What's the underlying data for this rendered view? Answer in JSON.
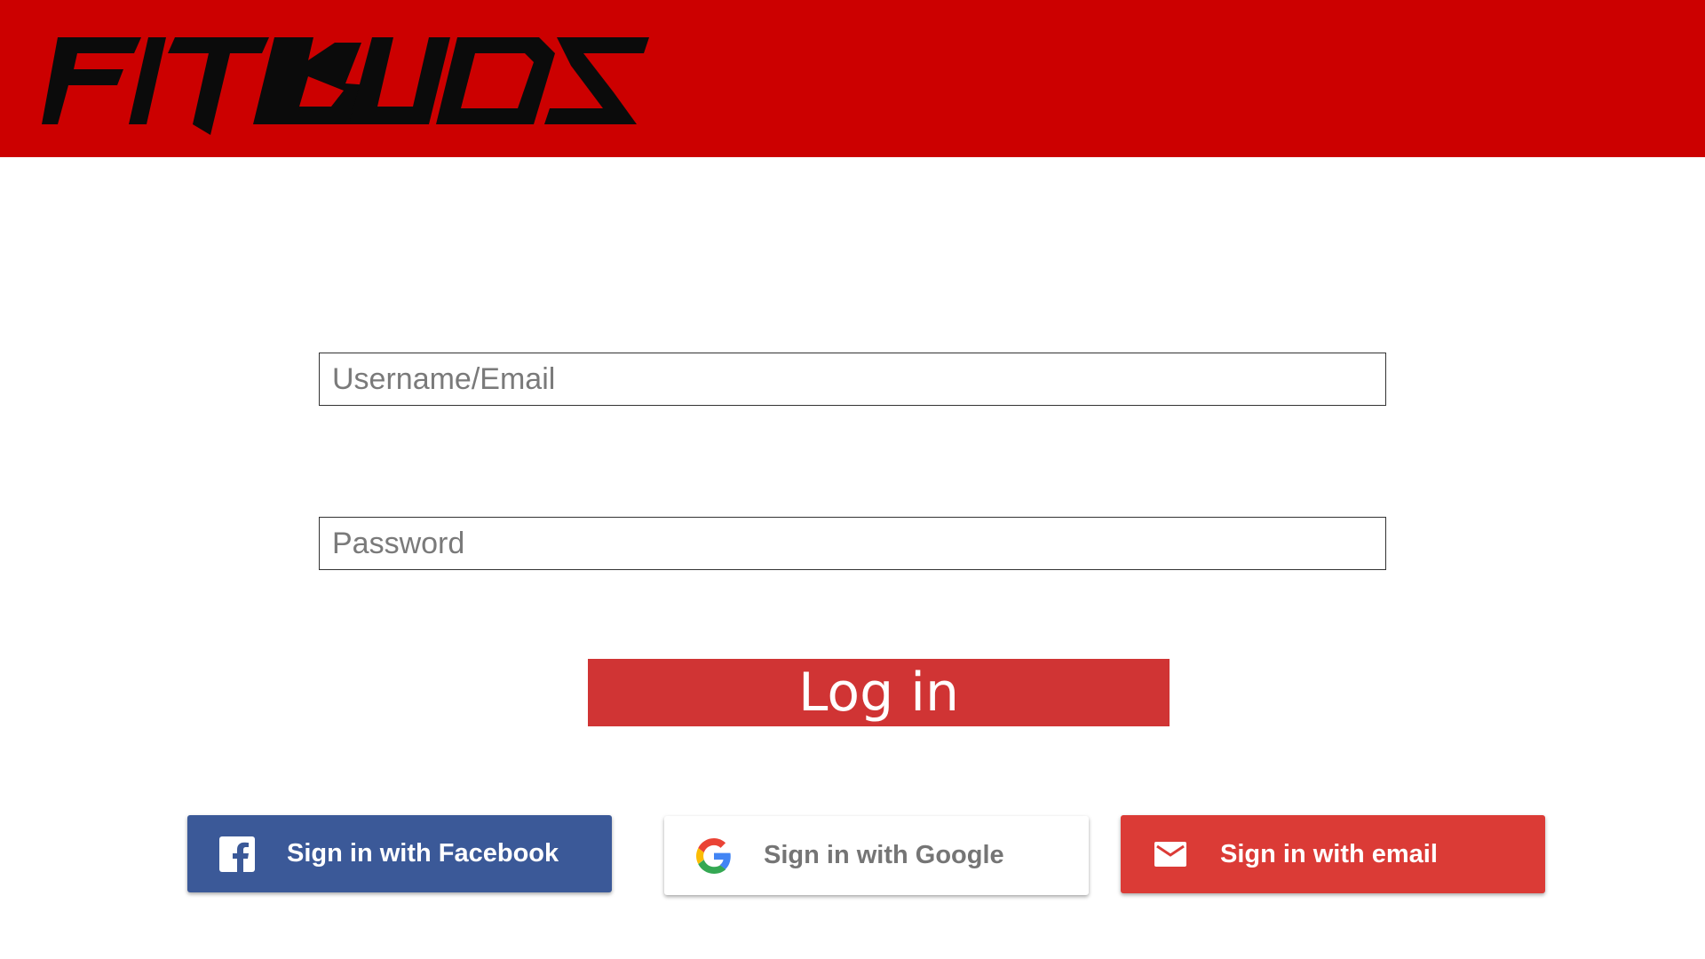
{
  "header": {
    "brand": "FITBUDS",
    "color": "#cc0000"
  },
  "form": {
    "username_placeholder": "Username/Email",
    "username_value": "",
    "password_placeholder": "Password",
    "password_value": "",
    "login_label": "Log in",
    "login_color": "#d03434"
  },
  "social": {
    "facebook_label": "Sign in with Facebook",
    "facebook_icon": "facebook-icon",
    "facebook_color": "#3b5998",
    "google_label": "Sign in with Google",
    "google_icon": "google-icon",
    "email_label": "Sign in with email",
    "email_icon": "mail-icon",
    "email_color": "#db3b36"
  }
}
